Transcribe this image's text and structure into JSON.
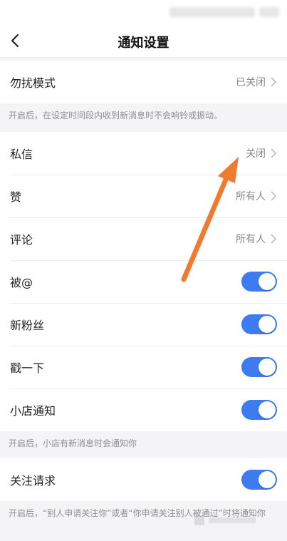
{
  "nav": {
    "title": "通知设置"
  },
  "dnd": {
    "label": "勿扰模式",
    "value": "已关闭",
    "hint": "开启后，在设定时间段内收到新消息时不会响铃或振动。"
  },
  "items": [
    {
      "label": "私信",
      "value": "关闭"
    },
    {
      "label": "赞",
      "value": "所有人"
    },
    {
      "label": "评论",
      "value": "所有人"
    },
    {
      "label": "被@"
    },
    {
      "label": "新粉丝"
    },
    {
      "label": "戳一下"
    },
    {
      "label": "小店通知"
    }
  ],
  "shop_hint": "开启后，小店有新消息时会通知你",
  "follow": {
    "label": "关注请求",
    "hint": "开启后，“别人申请关注你”或者“你申请关注别人被通过”时将通知你"
  },
  "toggles": {
    "on_color": "#3d7bf0"
  },
  "annotation": {
    "arrow_color": "#f07a2e"
  }
}
